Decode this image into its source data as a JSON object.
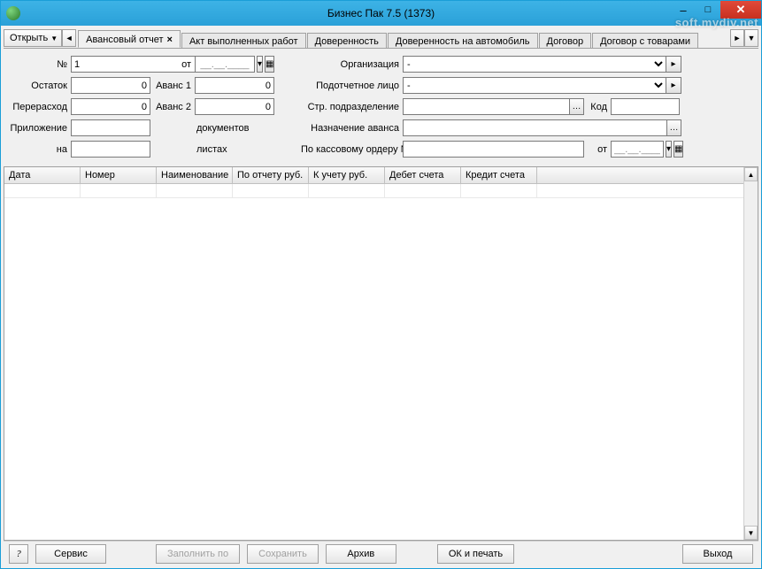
{
  "window": {
    "title": "Бизнес Пак 7.5 (1373)"
  },
  "watermark": "soft.mydiv.net",
  "open_button": "Открыть",
  "tabs": [
    {
      "label": "Авансовый отчет",
      "active": true,
      "closable": true
    },
    {
      "label": "Акт выполненных работ",
      "active": false
    },
    {
      "label": "Доверенность",
      "active": false
    },
    {
      "label": "Доверенность на автомобиль",
      "active": false
    },
    {
      "label": "Договор",
      "active": false
    },
    {
      "label": "Договор с товарами",
      "active": false
    }
  ],
  "form": {
    "number_label": "№",
    "number_value": "1",
    "ot_label": "от",
    "date_placeholder": "__.__.____",
    "org_label": "Организация",
    "org_value": "-",
    "ostatok_label": "Остаток",
    "ostatok_value": "0",
    "avans1_label": "Аванс 1",
    "avans1_value": "0",
    "person_label": "Подотчетное лицо",
    "person_value": "-",
    "pereraskhod_label": "Перерасход",
    "pereraskhod_value": "0",
    "avans2_label": "Аванс 2",
    "avans2_value": "0",
    "dept_label": "Стр. подразделение",
    "dept_value": "",
    "kod_label": "Код",
    "kod_value": "",
    "prilozh_label": "Приложение",
    "prilozh_value": "",
    "documents_label": "документов",
    "naznach_label": "Назначение аванса",
    "naznach_value": "",
    "na_label": "на",
    "na_value": "",
    "listah_label": "листах",
    "kassord_label": "По кассовому ордеру №",
    "kassord_value": "",
    "kassord_ot_label": "от"
  },
  "table": {
    "columns": [
      "Дата",
      "Номер",
      "Наименование",
      "По отчету руб.",
      "К учету руб.",
      "Дебет счета",
      "Кредит счета"
    ],
    "rows": []
  },
  "bottom": {
    "help": "?",
    "service": "Сервис",
    "fill_by": "Заполнить по",
    "save": "Сохранить",
    "archive": "Архив",
    "ok_print": "ОК и печать",
    "exit": "Выход"
  }
}
